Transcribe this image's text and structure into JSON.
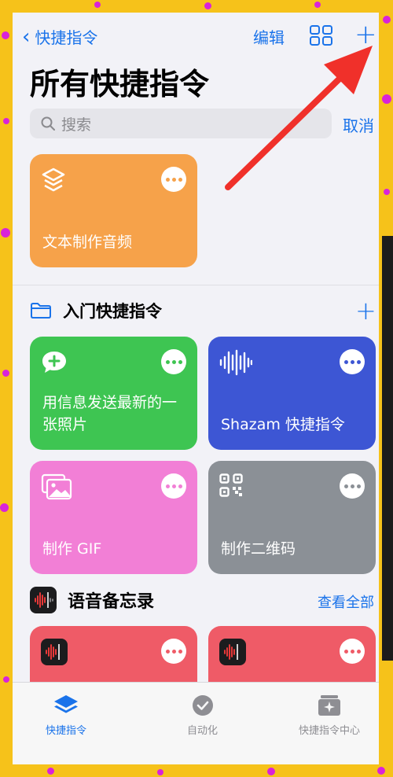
{
  "nav": {
    "back_label": "快捷指令",
    "edit_label": "编辑"
  },
  "page_title": "所有快捷指令",
  "search": {
    "placeholder": "搜索",
    "cancel_label": "取消"
  },
  "shortcuts_top": [
    {
      "label": "文本制作音频",
      "color": "#f6a24a",
      "icon": "stack-layers-icon"
    }
  ],
  "starter_section": {
    "title": "入门快捷指令",
    "tiles": [
      {
        "label": "用信息发送最新的一张照片",
        "color": "#3ec552",
        "icon": "message-plus-icon"
      },
      {
        "label": "Shazam 快捷指令",
        "color": "#3d56d4",
        "icon": "waveform-icon"
      },
      {
        "label": "制作 GIF",
        "color": "#f27fd6",
        "icon": "photos-icon"
      },
      {
        "label": "制作二维码",
        "color": "#8b9096",
        "icon": "qr-code-icon"
      }
    ]
  },
  "voice_section": {
    "title": "语音备忘录",
    "see_all_label": "查看全部",
    "tile_color": "#ef5b67"
  },
  "tabbar": [
    {
      "label": "快捷指令",
      "active": true,
      "icon": "layers-icon"
    },
    {
      "label": "自动化",
      "active": false,
      "icon": "clock-check-icon"
    },
    {
      "label": "快捷指令中心",
      "active": false,
      "icon": "sparkle-gallery-icon"
    }
  ],
  "colors": {
    "accent": "#1a73ea",
    "frame": "#f6c21a",
    "confetti": "#d923d9",
    "arrow": "#f0302a"
  }
}
